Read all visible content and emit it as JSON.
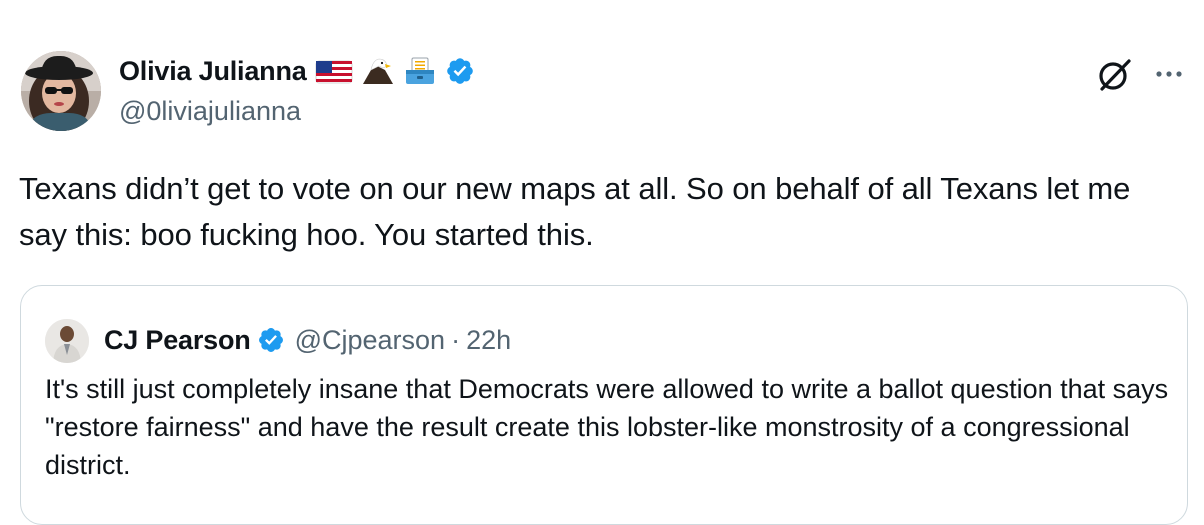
{
  "author": {
    "display_name": "Olivia Julianna",
    "handle": "@0liviajulianna",
    "emojis": [
      "us-flag-icon",
      "eagle-icon",
      "ballot-box-icon"
    ],
    "verified_color": "#1d9bf0"
  },
  "tweet": {
    "text": "Texans didn’t get to vote on our new maps at all. So on behalf of all Texans let me say this: boo fucking hoo. You started this."
  },
  "quote": {
    "display_name": "CJ Pearson",
    "handle": "@Cjpearson",
    "separator": "·",
    "time": "22h",
    "text": "It's still just completely insane that Democrats were allowed to write a ballot question that says \"restore fairness\" and have the result create this lobster-like monstrosity of a congressional district."
  },
  "actions": {
    "grok_icon": "grok-icon",
    "more_icon": "more-icon"
  },
  "colors": {
    "text_primary": "#0f1419",
    "text_secondary": "#536471",
    "border": "#cfd9de",
    "verified": "#1d9bf0"
  }
}
